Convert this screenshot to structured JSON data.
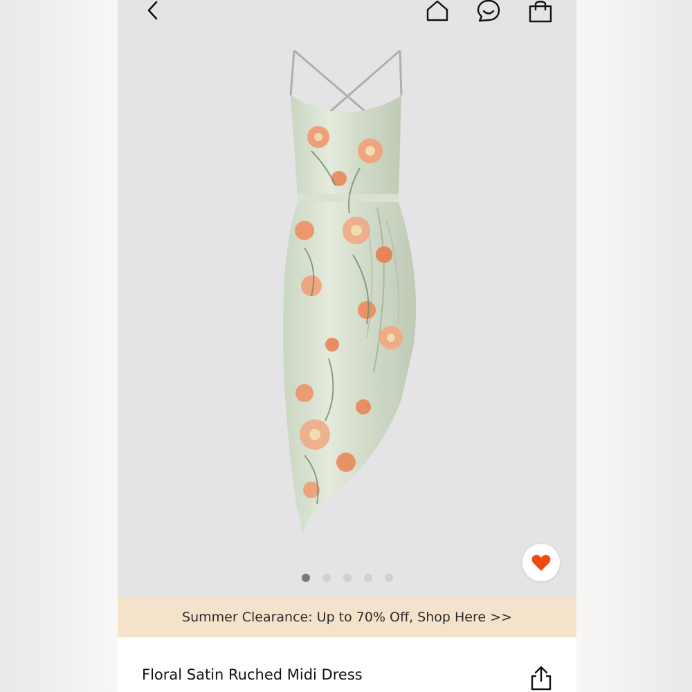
{
  "header": {
    "back_icon": "chevron-left-icon",
    "home_icon": "home-icon",
    "chat_icon": "chat-icon",
    "bag_icon": "shopping-bag-icon"
  },
  "gallery": {
    "image": "floral satin ruched midi dress product photo",
    "total_images": 5,
    "active_index": 0,
    "favorite_icon": "heart-icon",
    "favorite_color": "#f04a12"
  },
  "banner": {
    "text": "Summer Clearance: Up to 70% Off, Shop Here >>",
    "background": "#f4e3ca"
  },
  "product": {
    "title": "Floral Satin Ruched Midi Dress",
    "share_icon": "share-icon"
  }
}
